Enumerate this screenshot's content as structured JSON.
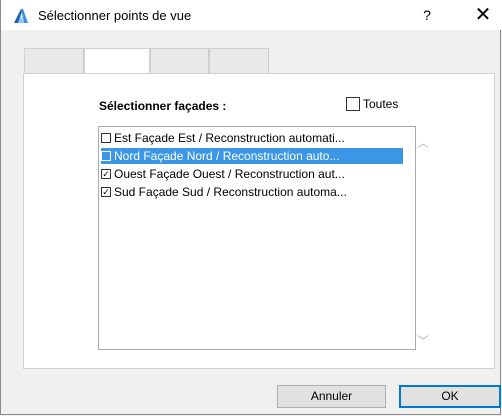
{
  "window": {
    "title": "Sélectionner points de vue",
    "help_label": "?",
    "close_label": "✕",
    "accent_color": "#0078d7"
  },
  "tabs": [
    {
      "label": ""
    },
    {
      "label": ""
    },
    {
      "label": ""
    },
    {
      "label": ""
    }
  ],
  "panel": {
    "select_label": "Sélectionner façades :",
    "all_checkbox": {
      "label": "Toutes",
      "checked": false
    }
  },
  "list": {
    "items": [
      {
        "label": "Est Façade Est / Reconstruction automati...",
        "checked": false,
        "selected": false
      },
      {
        "label": "Nord Façade Nord / Reconstruction auto...",
        "checked": false,
        "selected": true
      },
      {
        "label": "Ouest Façade Ouest / Reconstruction aut...",
        "checked": true,
        "selected": false
      },
      {
        "label": "Sud Façade Sud / Reconstruction automa...",
        "checked": true,
        "selected": false
      }
    ],
    "selection_color": "#3b96e5"
  },
  "buttons": {
    "cancel_label": "Annuler",
    "ok_label": "OK"
  }
}
